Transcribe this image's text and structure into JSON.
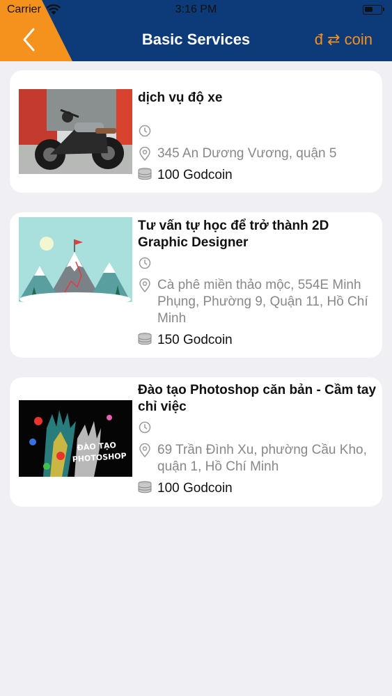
{
  "status_bar": {
    "carrier": "Carrier",
    "time": "3:16 PM"
  },
  "header": {
    "title": "Basic Services",
    "coin_switch_label": "đ ⇄ coin"
  },
  "services": [
    {
      "title": "dịch vụ độ xe",
      "time": "",
      "address": "345 An Dương Vương, quận 5",
      "price": "100 Godcoin"
    },
    {
      "title": "Tư vấn tự học để trở thành 2D Graphic Designer",
      "time": "",
      "address": "Cà phê miền thảo mộc, 554E Minh Phụng, Phường 9, Quận 11, Hồ Chí Minh",
      "price": "150 Godcoin"
    },
    {
      "title": "Đào tạo Photoshop căn bản - Cầm tay chỉ việc",
      "time": "",
      "address": "69 Trần Đình Xu, phường Cầu Kho, quận 1, Hồ Chí Minh",
      "price": "100 Godcoin"
    }
  ],
  "thumbnail_texts": {
    "photoshop_line1": "ĐÀO TẠO",
    "photoshop_line2": "PHOTOSHOP"
  },
  "colors": {
    "header_bg": "#0d3a78",
    "accent_orange": "#f5921e",
    "page_bg": "#efeff4",
    "card_bg": "#ffffff",
    "address_gray": "#888888"
  },
  "icons": {
    "time": "clock-icon",
    "address": "location-pin-icon",
    "price": "coin-stack-icon",
    "back": "chevron-left-icon"
  }
}
